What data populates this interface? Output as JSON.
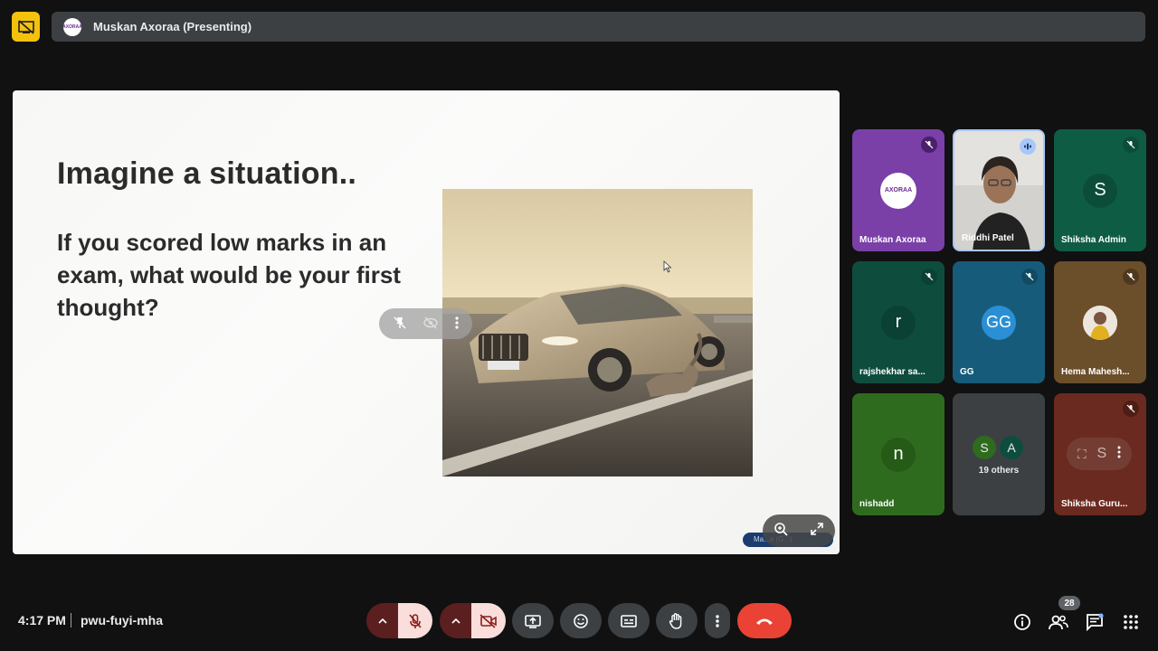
{
  "top_bar": {
    "presenter_name": "Muskan Axoraa (Presenting)",
    "presenter_avatar_text": "AXORAA"
  },
  "slide": {
    "title": "Imagine a situation..",
    "body": "If you scored low marks in an exam, what would be your first thought?",
    "name_tag": "Ma...a (G...)"
  },
  "participants": [
    {
      "name": "Muskan Axoraa",
      "initial": "AXORAA",
      "bg": "#7b3fa8",
      "muted": true
    },
    {
      "name": "Riddhi Patel",
      "initial": "",
      "bg": "#d8d6d2",
      "muted": false,
      "speaking": true
    },
    {
      "name": "Shiksha Admin",
      "initial": "S",
      "bg": "#0f5c44",
      "muted": true
    },
    {
      "name": "rajshekhar sa...",
      "initial": "r",
      "bg": "#0e4d3e",
      "muted": true
    },
    {
      "name": "GG",
      "initial": "GG",
      "bg": "#175b7a",
      "muted": true
    },
    {
      "name": "Hema Mahesh...",
      "initial": "",
      "bg": "#6b4e2a",
      "muted": true
    },
    {
      "name": "nishadd",
      "initial": "n",
      "bg": "#2f6b1e",
      "muted": false
    },
    {
      "name": "",
      "others_label": "19 others",
      "others_initials": [
        "S",
        "A"
      ],
      "bg": "#3c4043",
      "muted": false
    },
    {
      "name": "Shiksha Guru...",
      "initial": "S",
      "bg": "#6b2a20",
      "muted": true
    }
  ],
  "bottom_bar": {
    "time": "4:17 PM",
    "meeting_code": "pwu-fuyi-mha",
    "people_count": "28"
  },
  "colors": {
    "end_call": "#ea4335",
    "present_accent": "#f4c20d",
    "muted_pink": "#f9dedc"
  }
}
